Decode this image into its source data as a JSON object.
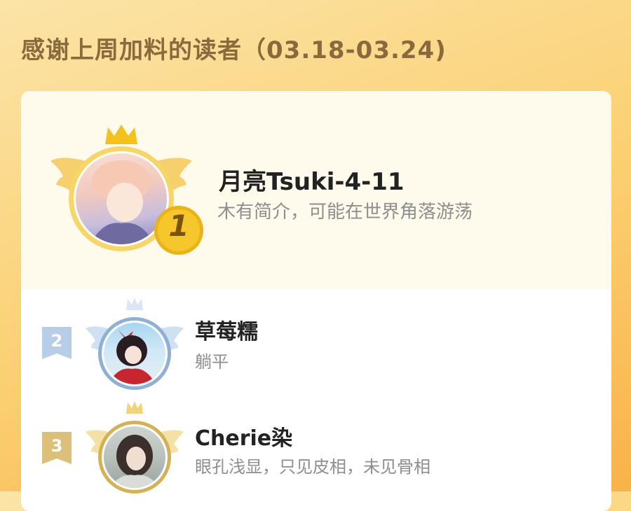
{
  "header": {
    "title": "感谢上周加料的读者（03.18-03.24)"
  },
  "ranking": [
    {
      "rank": "1",
      "name": "月亮Tsuki-4-11",
      "bio": "木有简介，可能在世界角落游荡"
    },
    {
      "rank": "2",
      "name": "草莓糯",
      "bio": "躺平"
    },
    {
      "rank": "3",
      "name": "Cherie染",
      "bio": "眼孔浅显，只见皮相，未见骨相"
    }
  ],
  "colors": {
    "gold": "#f4c21d",
    "silver": "#a9c3e2",
    "bronze": "#d7b25a",
    "title_text": "#8a6a3c"
  }
}
